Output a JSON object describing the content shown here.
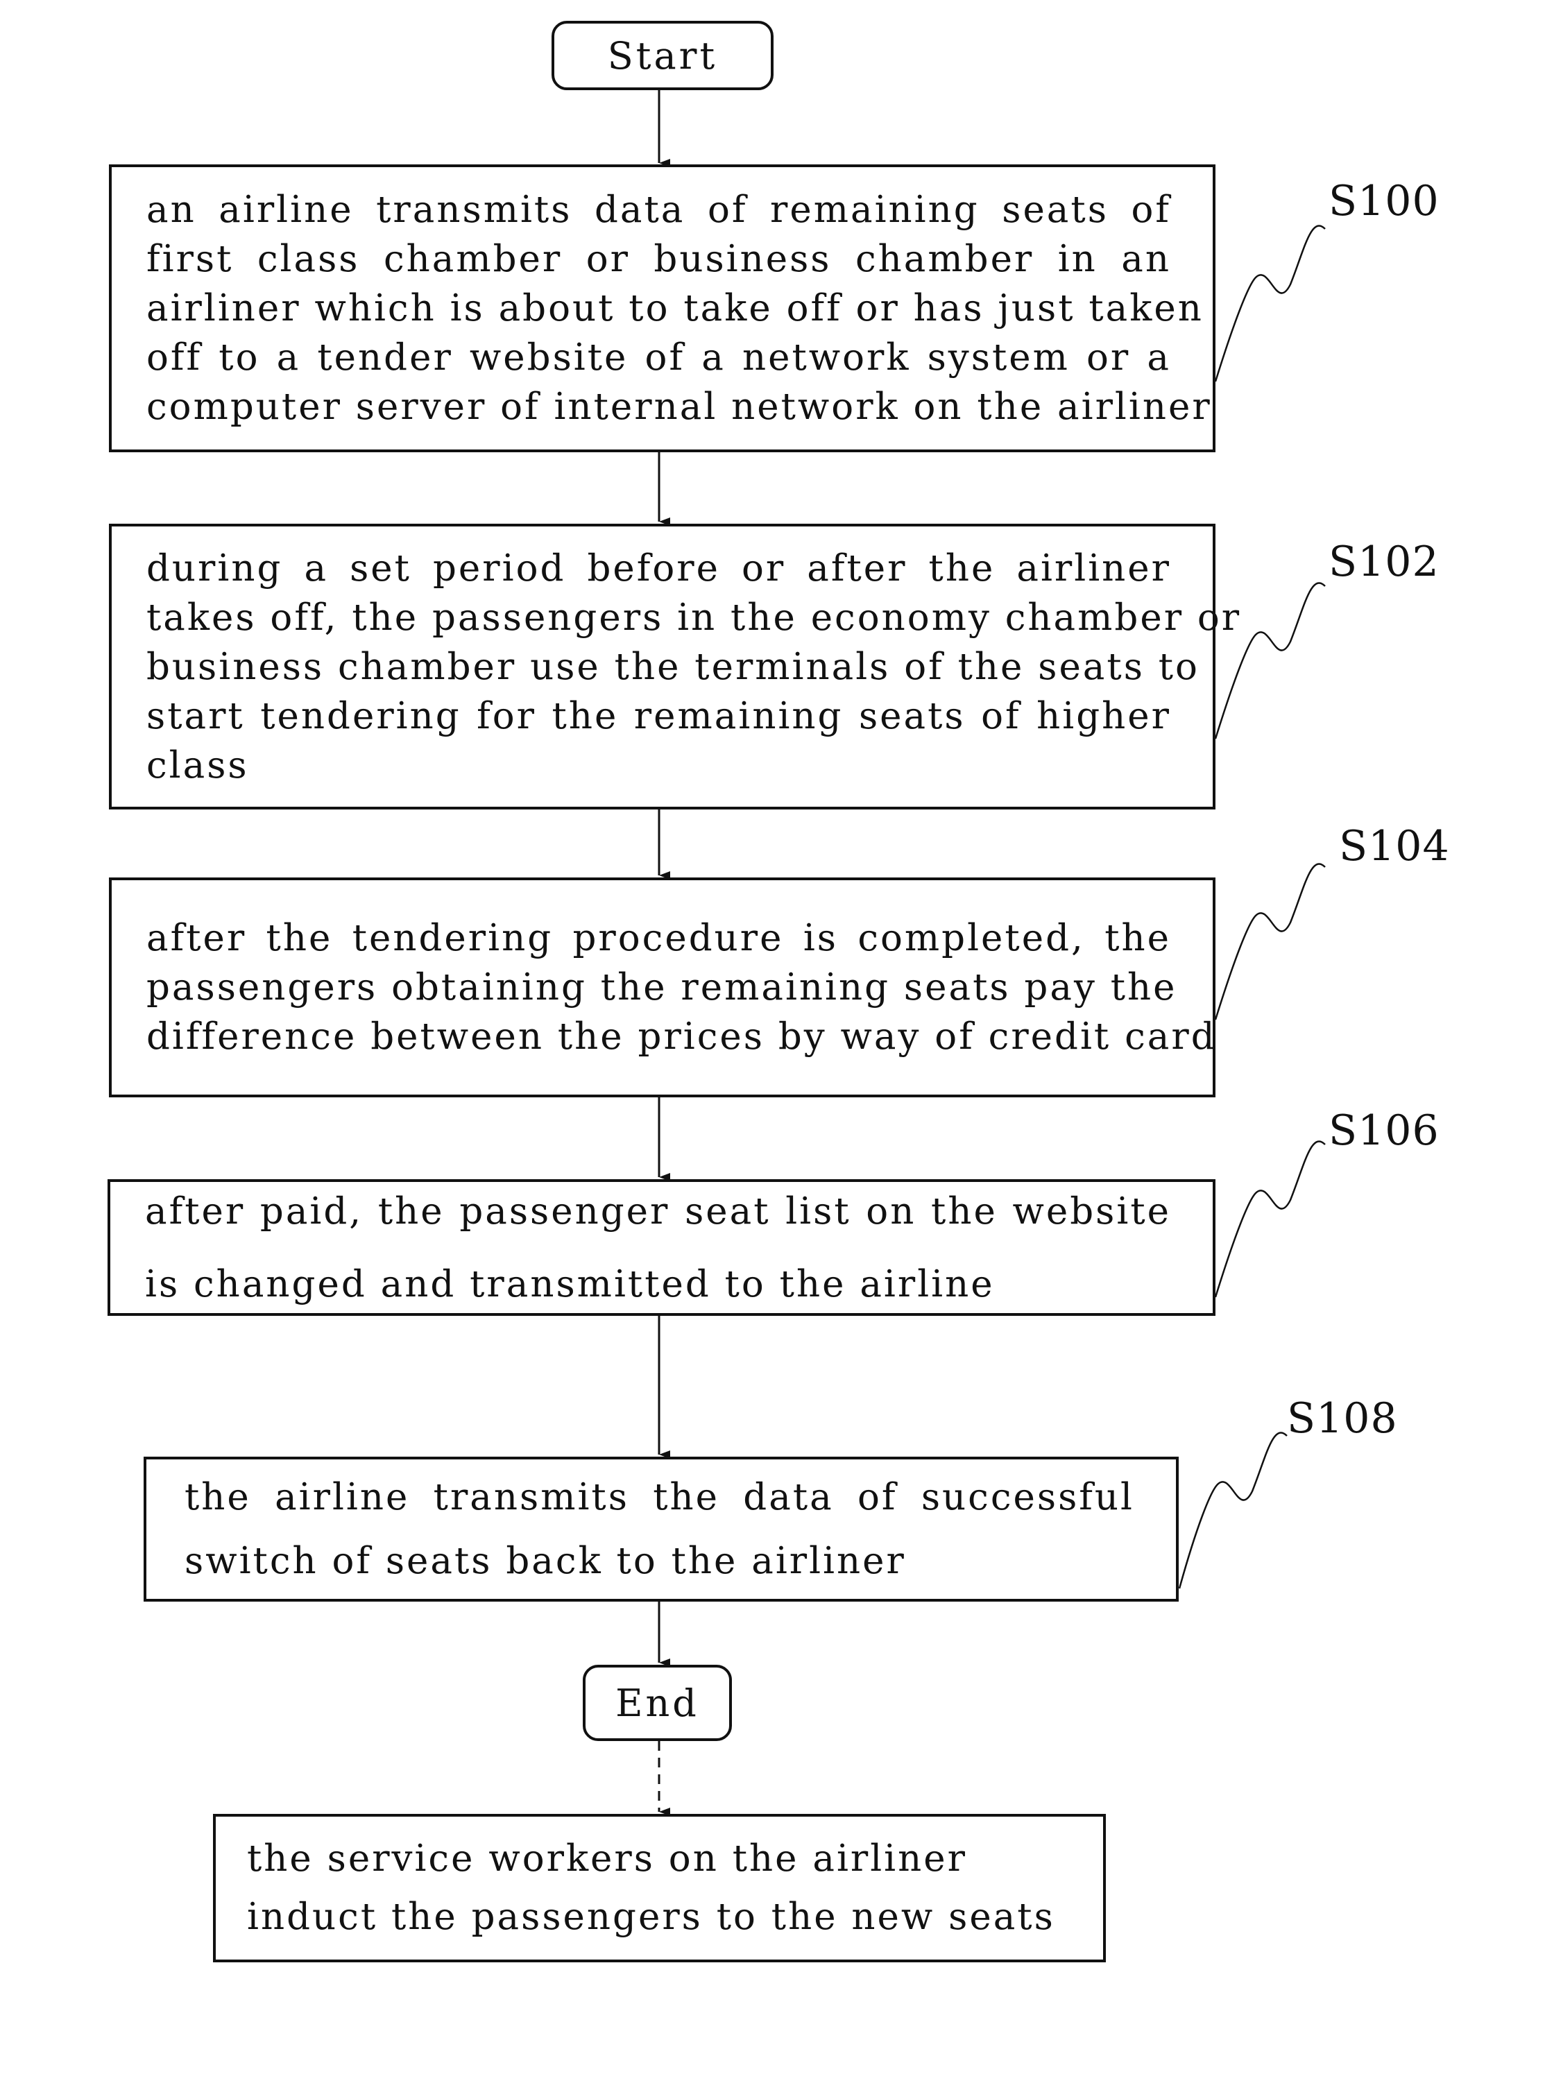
{
  "diagram": {
    "start_label": "Start",
    "end_label": "End",
    "steps": [
      {
        "id": "S100",
        "lines": [
          "an airline transmits data of remaining seats of",
          "first class chamber or business chamber in an",
          "airliner which is about to take off or has just taken",
          "off to a tender website of a network system or a",
          "computer server of internal network on the airliner"
        ]
      },
      {
        "id": "S102",
        "lines": [
          "during a set period before or after the airliner",
          "takes off, the passengers in the economy chamber or",
          "business chamber use the terminals of the seats to",
          "start tendering for the remaining seats of higher",
          "class"
        ]
      },
      {
        "id": "S104",
        "lines": [
          "after the tendering procedure is completed, the",
          "passengers obtaining the remaining seats pay the",
          "difference between the prices by way of credit card"
        ]
      },
      {
        "id": "S106",
        "lines": [
          "after paid, the passenger seat list on the website",
          "is changed and transmitted to the airline"
        ]
      },
      {
        "id": "S108",
        "lines": [
          "the airline transmits the data of successful",
          "switch of seats back to the airliner"
        ]
      }
    ],
    "final_step": {
      "lines": [
        "the service workers on the airliner",
        "induct the passengers to the new seats"
      ]
    }
  }
}
